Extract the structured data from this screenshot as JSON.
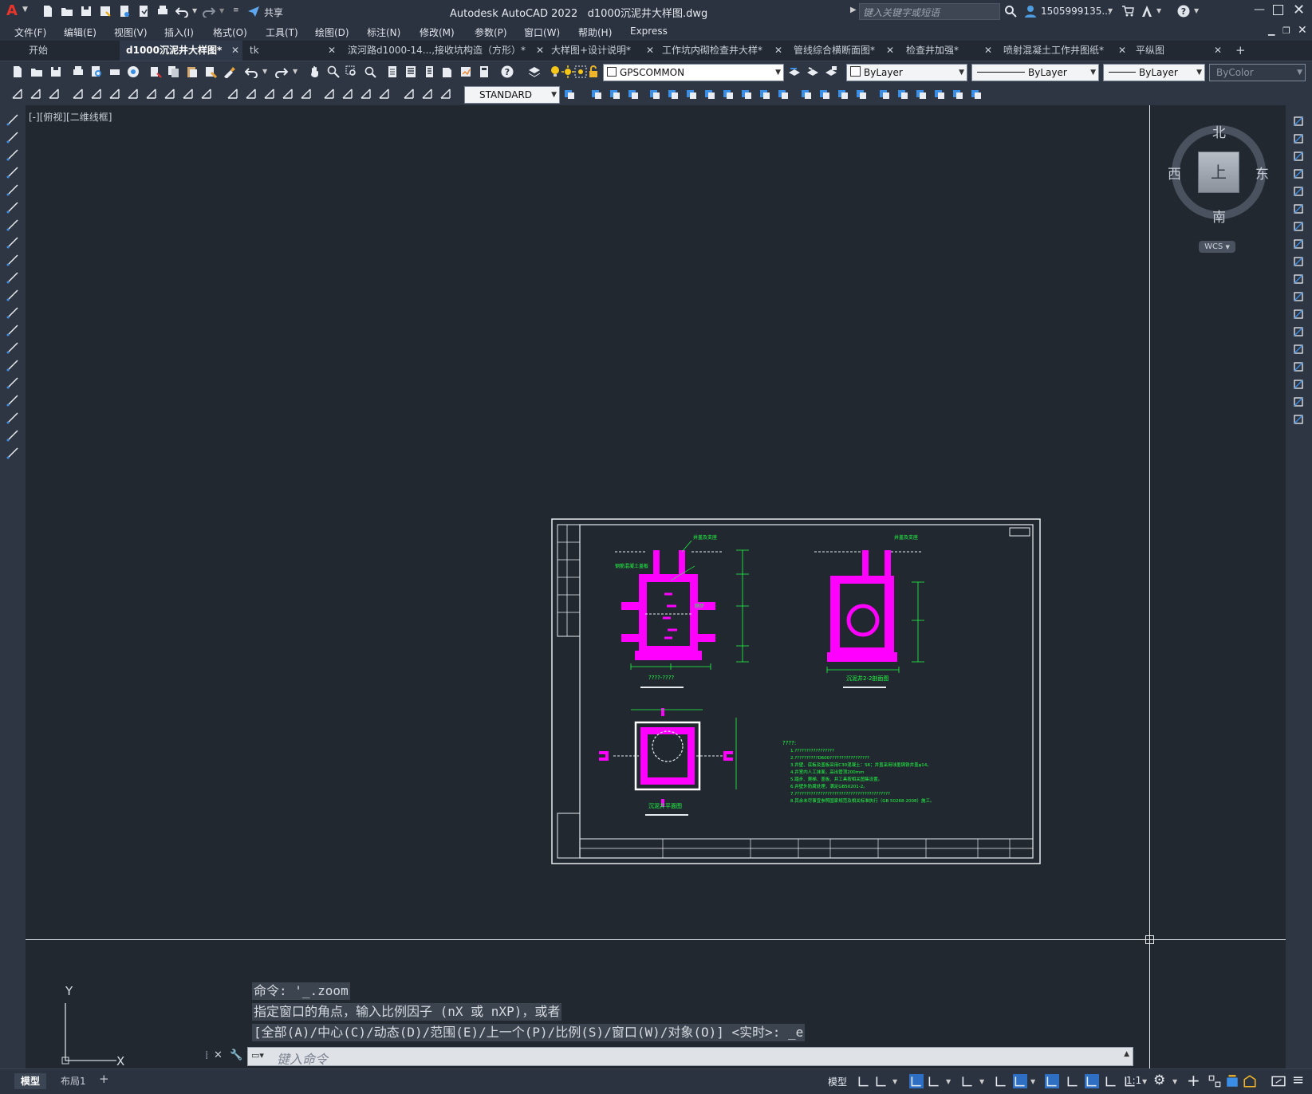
{
  "app": {
    "logo": "A",
    "title": "Autodesk AutoCAD 2022",
    "filename": "d1000沉泥井大样图.dwg",
    "share_label": "共享",
    "search_placeholder": "键入关键字或短语",
    "user": "1505999135...",
    "window_controls": [
      "minimize-icon",
      "maximize-icon",
      "close-icon"
    ]
  },
  "menu": [
    "文件(F)",
    "编辑(E)",
    "视图(V)",
    "插入(I)",
    "格式(O)",
    "工具(T)",
    "绘图(D)",
    "标注(N)",
    "修改(M)",
    "参数(P)",
    "窗口(W)",
    "帮助(H)",
    "Express"
  ],
  "tabs": [
    {
      "label": "开始",
      "active": false,
      "closable": false
    },
    {
      "label": "d1000沉泥井大样图*",
      "active": true,
      "closable": true
    },
    {
      "label": "tk",
      "active": false,
      "closable": true
    },
    {
      "label": "滨河路d1000-14...,接收坑构造（方形）*",
      "active": false,
      "closable": true
    },
    {
      "label": "大样图+设计说明*",
      "active": false,
      "closable": true
    },
    {
      "label": "工作坑内砌检查井大样*",
      "active": false,
      "closable": true
    },
    {
      "label": "管线综合横断面图*",
      "active": false,
      "closable": true
    },
    {
      "label": "检查井加强*",
      "active": false,
      "closable": true
    },
    {
      "label": "喷射混凝土工作井图纸*",
      "active": false,
      "closable": true
    },
    {
      "label": "平纵图",
      "active": false,
      "closable": true
    }
  ],
  "toolbar": {
    "layer": "GPSCOMMON",
    "color": "ByLayer",
    "linetype": "ByLayer",
    "lineweight": "ByLayer",
    "plotstyle": "ByColor",
    "textstyle": "STANDARD"
  },
  "viewport": {
    "label": "[-][俯视][二维线框]",
    "viewcube": {
      "north": "北",
      "south": "南",
      "east": "东",
      "west": "西",
      "top": "上",
      "wcs": "WCS"
    },
    "ucs": {
      "x": "X",
      "y": "Y"
    }
  },
  "drawing": {
    "section1_title": "????-????",
    "section2_title": "沉泥井2-2剖面图",
    "plan_title": "沉泥井平面图",
    "notes_heading": "????:",
    "notes": [
      "1.?????????????????",
      "2.??????????D600?????????????????",
      "3.井壁、底板及盖板采用C30混凝土：S6；井盖采用球墨铸铁井盖φ14。",
      "4.井室内人工抹面，高出管顶200mm",
      "5.踏步、爬梯、盖板、井工具按相关图集设置。",
      "6.井壁外防腐处理，满足GB50201-2。",
      "7.?????????????????????????????????????????",
      "8.其余未尽事宜参照国家规范及相关标准执行（GB 50268-2008）施工。"
    ]
  },
  "command": {
    "history": [
      "命令: '_.zoom",
      "指定窗口的角点，输入比例因子 (nX 或 nXP)，或者",
      "[全部(A)/中心(C)/动态(D)/范围(E)/上一个(P)/比例(S)/窗口(W)/对象(O)] <实时>: _e"
    ],
    "placeholder": "键入命令"
  },
  "status": {
    "layout_tabs": [
      "模型",
      "布局1"
    ],
    "model_label": "模型",
    "scale": "1:1"
  }
}
